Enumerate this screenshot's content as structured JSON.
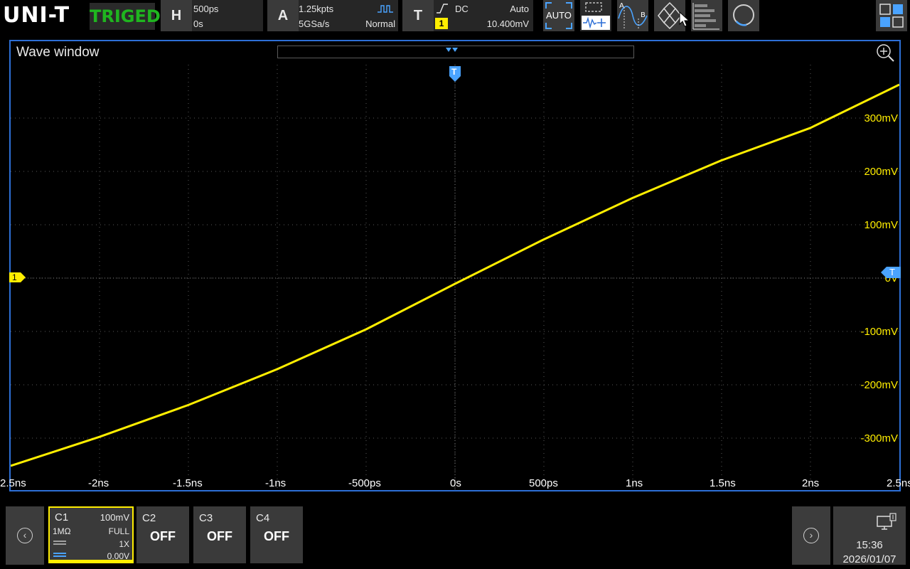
{
  "brand": {
    "logo_text": "UNI-T",
    "trigger_status": "TRIGED",
    "status_color": "#1fb51f"
  },
  "horizontal": {
    "key": "H",
    "timebase": "500ps",
    "position": "0s"
  },
  "acquire": {
    "key": "A",
    "memory_depth": "1.25kpts",
    "sample_rate": "5GSa/s",
    "mode": "Normal"
  },
  "trigger": {
    "key": "T",
    "coupling": "DC",
    "sweep": "Auto",
    "source": "1",
    "level": "10.400mV"
  },
  "toolbar": {
    "auto_label": "AUTO",
    "icons": [
      "region-select-icon",
      "cursor-ab-icon",
      "pass-fail-icon",
      "measure-bars-icon",
      "search-icon",
      "window-layout-icon"
    ]
  },
  "wave_window": {
    "title": "Wave window",
    "channel_marker": "1",
    "trigger_marker": "T",
    "y_labels": [
      "300mV",
      "200mV",
      "100mV",
      "0V",
      "-100mV",
      "-200mV",
      "-300mV"
    ],
    "x_labels": [
      "-2.5ns",
      "-2ns",
      "-1.5ns",
      "-1ns",
      "-500ps",
      "0s",
      "500ps",
      "1ns",
      "1.5ns",
      "2ns",
      "2.5ns"
    ],
    "trace_color": "#ffee00",
    "grid_color": "#5a5a5a"
  },
  "channels": {
    "c1": {
      "name": "C1",
      "scale": "100mV",
      "impedance": "1MΩ",
      "bandwidth": "FULL",
      "probe": "1X",
      "offset": "0.00V"
    },
    "c2": {
      "name": "C2",
      "state": "OFF"
    },
    "c3": {
      "name": "C3",
      "state": "OFF"
    },
    "c4": {
      "name": "C4",
      "state": "OFF"
    }
  },
  "clock": {
    "time": "15:36",
    "date": "2026/01/07"
  },
  "chart_data": {
    "type": "line",
    "xlabel": "",
    "ylabel": "",
    "xlim": [
      -2.5,
      2.5
    ],
    "x_unit": "ns",
    "ylim": [
      -375,
      375
    ],
    "y_unit": "mV",
    "grid": true,
    "series": [
      {
        "values_x": [
          -2.5,
          -2.0,
          -1.5,
          -1.0,
          -0.5,
          0.0,
          0.5,
          1.0,
          1.5,
          2.0,
          2.5
        ],
        "values_y": [
          -330,
          -279,
          -223,
          -160,
          -90,
          -10,
          68,
          141,
          207,
          264,
          340
        ]
      }
    ]
  }
}
